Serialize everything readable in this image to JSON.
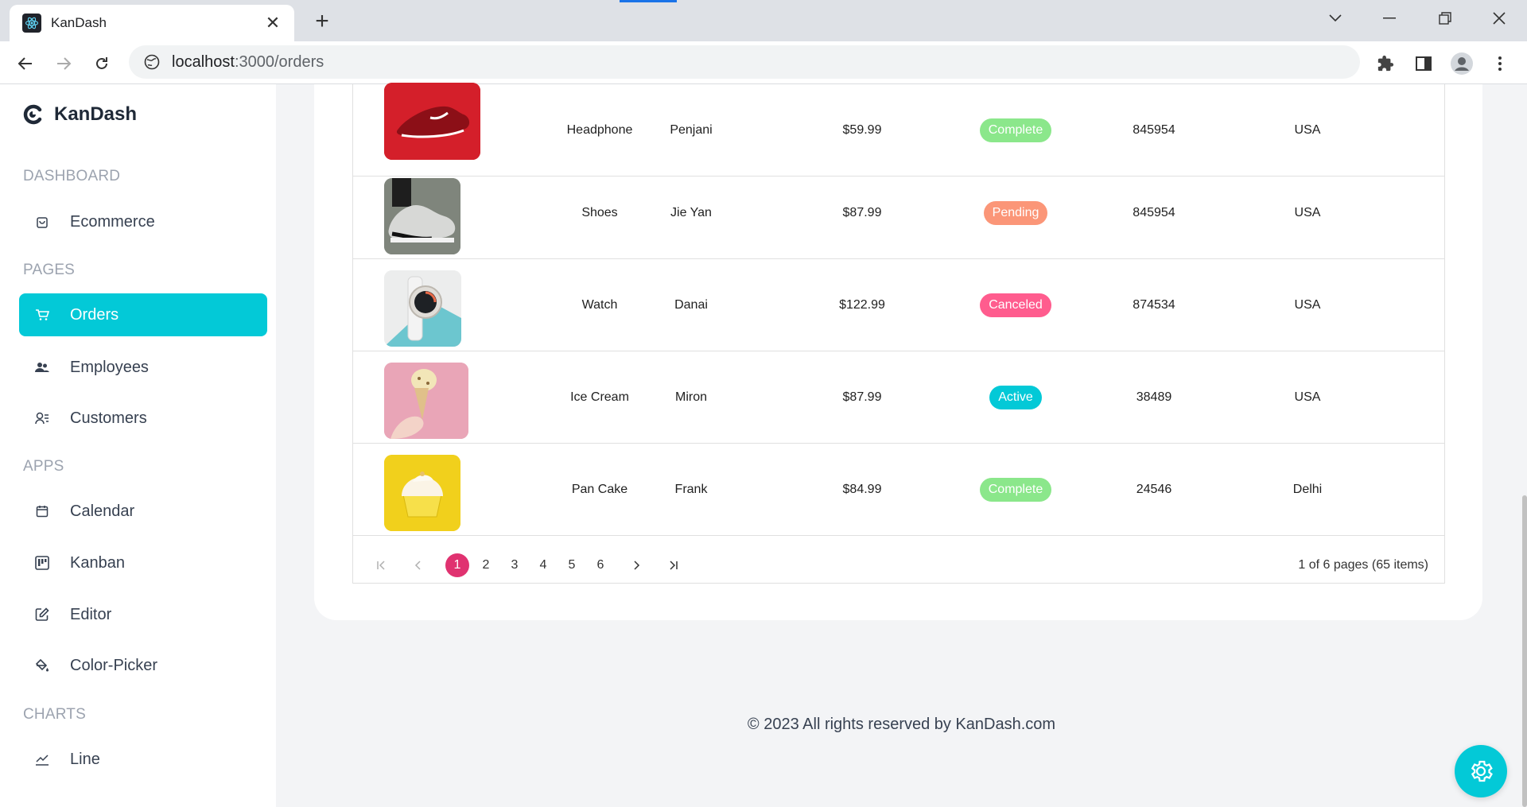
{
  "browser": {
    "tab_title": "KanDash",
    "url_host": "localhost",
    "url_path": ":3000/orders"
  },
  "sidebar": {
    "brand": "KanDash",
    "sections": [
      {
        "title": "DASHBOARD",
        "items": [
          {
            "label": "Ecommerce",
            "icon": "shopping-bag-icon"
          }
        ]
      },
      {
        "title": "PAGES",
        "items": [
          {
            "label": "Orders",
            "icon": "cart-icon",
            "active": true
          },
          {
            "label": "Employees",
            "icon": "users-icon"
          },
          {
            "label": "Customers",
            "icon": "customers-icon"
          }
        ]
      },
      {
        "title": "APPS",
        "items": [
          {
            "label": "Calendar",
            "icon": "calendar-icon"
          },
          {
            "label": "Kanban",
            "icon": "kanban-icon"
          },
          {
            "label": "Editor",
            "icon": "edit-icon"
          },
          {
            "label": "Color-Picker",
            "icon": "paint-bucket-icon"
          }
        ]
      },
      {
        "title": "CHARTS",
        "items": [
          {
            "label": "Line",
            "icon": "line-chart-icon"
          }
        ]
      }
    ]
  },
  "orders": {
    "rows": [
      {
        "item": "Headphone",
        "customer": "Penjani",
        "amount": "$59.99",
        "status": "Complete",
        "order_id": "845954",
        "location": "USA"
      },
      {
        "item": "Shoes",
        "customer": "Jie Yan",
        "amount": "$87.99",
        "status": "Pending",
        "order_id": "845954",
        "location": "USA"
      },
      {
        "item": "Watch",
        "customer": "Danai",
        "amount": "$122.99",
        "status": "Canceled",
        "order_id": "874534",
        "location": "USA"
      },
      {
        "item": "Ice Cream",
        "customer": "Miron",
        "amount": "$87.99",
        "status": "Active",
        "order_id": "38489",
        "location": "USA"
      },
      {
        "item": "Pan Cake",
        "customer": "Frank",
        "amount": "$84.99",
        "status": "Complete",
        "order_id": "24546",
        "location": "Delhi"
      }
    ],
    "status_colors": {
      "Complete": "#8be78b",
      "Pending": "#fb9678",
      "Canceled": "#ff5c8e",
      "Active": "#03c9d7"
    }
  },
  "pager": {
    "pages": [
      "1",
      "2",
      "3",
      "4",
      "5",
      "6"
    ],
    "current": "1",
    "info": "1 of 6 pages (65 items)"
  },
  "footer": "© 2023 All rights reserved by KanDash.com",
  "colors": {
    "accent": "#03c9d7",
    "pager_active": "#e03270"
  }
}
